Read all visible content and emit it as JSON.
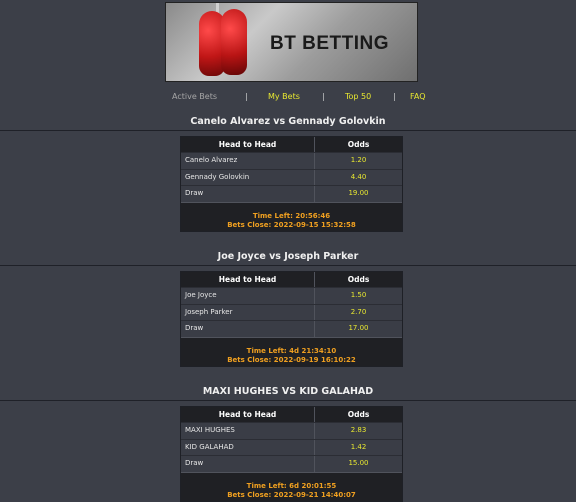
{
  "banner": {
    "title": "BT BETTING"
  },
  "nav": {
    "items": [
      {
        "label": "Active Bets"
      },
      {
        "label": "My Bets"
      },
      {
        "label": "Top 50"
      },
      {
        "label": "FAQ"
      }
    ],
    "separator": "|"
  },
  "table_headers": {
    "col1": "Head to Head",
    "col2": "Odds"
  },
  "matches": [
    {
      "title": "Canelo Alvarez vs Gennady Golovkin",
      "rows": [
        {
          "name": "Canelo Alvarez",
          "odds": "1.20"
        },
        {
          "name": "Gennady Golovkin",
          "odds": "4.40"
        },
        {
          "name": "Draw",
          "odds": "19.00"
        }
      ],
      "time_left": "Time Left: 20:56:46",
      "bets_close": "Bets Close: 2022-09-15 15:32:58"
    },
    {
      "title": "Joe Joyce vs Joseph Parker",
      "rows": [
        {
          "name": "Joe Joyce",
          "odds": "1.50"
        },
        {
          "name": "Joseph Parker",
          "odds": "2.70"
        },
        {
          "name": "Draw",
          "odds": "17.00"
        }
      ],
      "time_left": "Time Left: 4d 21:34:10",
      "bets_close": "Bets Close: 2022-09-19 16:10:22"
    },
    {
      "title": "MAXI HUGHES VS KID GALAHAD",
      "rows": [
        {
          "name": "MAXI HUGHES",
          "odds": "2.83"
        },
        {
          "name": "KID GALAHAD",
          "odds": "1.42"
        },
        {
          "name": "Draw",
          "odds": "15.00"
        }
      ],
      "time_left": "Time Left: 6d 20:01:55",
      "bets_close": "Bets Close: 2022-09-21 14:40:07"
    }
  ],
  "colors": {
    "background": "#3c3f48",
    "link": "#e8e830",
    "footer_text": "#f0a020",
    "table_header_bg": "#1f2024"
  }
}
